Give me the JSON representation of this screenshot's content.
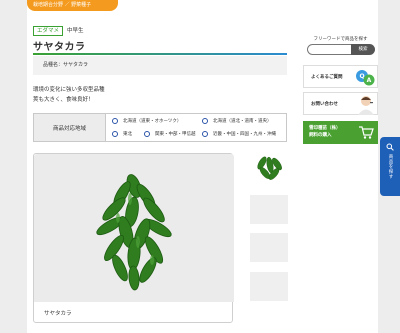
{
  "breadcrumb": "栽培期合分野 ／ 野菜種子",
  "tags": {
    "category": "エダマメ",
    "maturity": "中早生"
  },
  "product": {
    "title": "サヤタカラ",
    "variety_label": "品種名：サヤタカラ",
    "description": [
      "環境の変化に強い多収型品種",
      "莢も大きく、食味良好！"
    ]
  },
  "regions": {
    "label": "商品対応地域",
    "options": [
      "北海道（道東・オホーツク）",
      "北海道（道北・道南・道央）",
      "東北",
      "関東・中部・甲信越",
      "近畿・中国・四国・九州・沖縄"
    ]
  },
  "gallery": {
    "caption": "サヤタカラ"
  },
  "sidebar": {
    "search_title": "フリーワードで商品を探す",
    "search_placeholder": "",
    "search_button": "検索",
    "faq_label": "よくあるご質問",
    "contact_label": "お問い合わせ",
    "green_line1": "雪印種苗（株）",
    "green_line2": "飼料の購入"
  },
  "float_button": {
    "label": "商品を探す"
  },
  "colors": {
    "accent_green": "#3aa133",
    "accent_blue": "#2b8bd1",
    "brand_orange": "#f39a1f",
    "float_blue": "#1e5fb8"
  }
}
